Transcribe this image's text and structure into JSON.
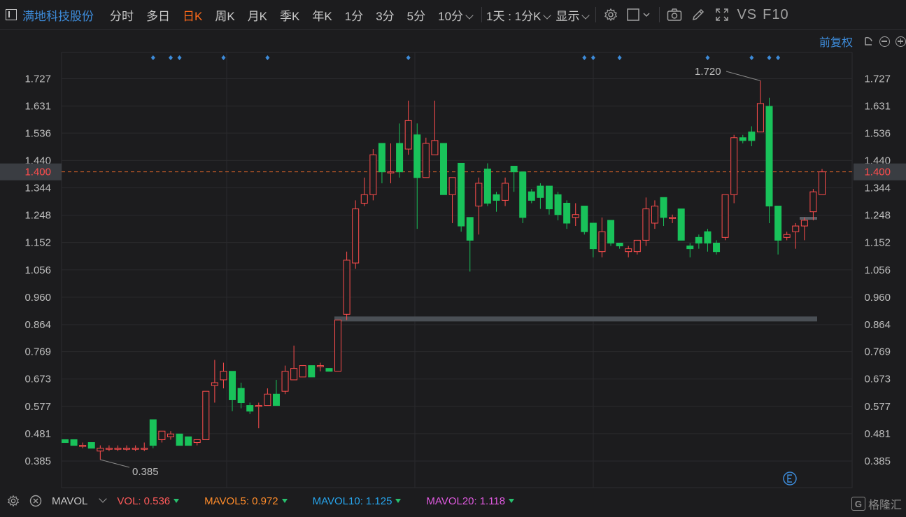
{
  "toolbar": {
    "stock_name": "满地科技股份",
    "periods": [
      "分时",
      "多日",
      "日K",
      "周K",
      "月K",
      "季K",
      "年K",
      "1分",
      "3分",
      "5分",
      "10分"
    ],
    "active_period": "日K",
    "interval_label": "1天 : 1分K",
    "display_label": "显示",
    "vs_label": "VS",
    "f10_label": "F10"
  },
  "subheader": {
    "adjust_label": "前复权"
  },
  "chart_data": {
    "type": "candlestick",
    "y_ticks": [
      "1.727",
      "1.631",
      "1.536",
      "1.440",
      "1.344",
      "1.248",
      "1.152",
      "1.056",
      "0.960",
      "0.864",
      "0.769",
      "0.673",
      "0.577",
      "0.481",
      "0.385"
    ],
    "ylim": [
      0.385,
      1.727
    ],
    "current_price": "1.400",
    "max_label": "1.720",
    "min_label": "0.385",
    "candles": [
      [
        0.46,
        0.45,
        0.46,
        0.45
      ],
      [
        0.46,
        0.44,
        0.46,
        0.44
      ],
      [
        0.44,
        0.44,
        0.45,
        0.43
      ],
      [
        0.45,
        0.43,
        0.45,
        0.43
      ],
      [
        0.42,
        0.43,
        0.44,
        0.39
      ],
      [
        0.43,
        0.43,
        0.44,
        0.42
      ],
      [
        0.43,
        0.43,
        0.44,
        0.42
      ],
      [
        0.43,
        0.43,
        0.44,
        0.42
      ],
      [
        0.43,
        0.43,
        0.44,
        0.42
      ],
      [
        0.43,
        0.43,
        0.45,
        0.42
      ],
      [
        0.53,
        0.44,
        0.53,
        0.43
      ],
      [
        0.46,
        0.49,
        0.49,
        0.45
      ],
      [
        0.47,
        0.48,
        0.49,
        0.46
      ],
      [
        0.48,
        0.44,
        0.48,
        0.44
      ],
      [
        0.47,
        0.44,
        0.47,
        0.44
      ],
      [
        0.45,
        0.46,
        0.46,
        0.44
      ],
      [
        0.46,
        0.63,
        0.63,
        0.46
      ],
      [
        0.65,
        0.66,
        0.74,
        0.59
      ],
      [
        0.67,
        0.7,
        0.73,
        0.64
      ],
      [
        0.7,
        0.6,
        0.7,
        0.56
      ],
      [
        0.64,
        0.59,
        0.66,
        0.57
      ],
      [
        0.58,
        0.56,
        0.59,
        0.55
      ],
      [
        0.58,
        0.58,
        0.59,
        0.5
      ],
      [
        0.58,
        0.62,
        0.64,
        0.58
      ],
      [
        0.62,
        0.58,
        0.67,
        0.58
      ],
      [
        0.63,
        0.7,
        0.72,
        0.62
      ],
      [
        0.67,
        0.71,
        0.79,
        0.67
      ],
      [
        0.68,
        0.72,
        0.72,
        0.68
      ],
      [
        0.72,
        0.68,
        0.72,
        0.68
      ],
      [
        0.72,
        0.72,
        0.73,
        0.7
      ],
      [
        0.71,
        0.7,
        0.71,
        0.7
      ],
      [
        0.7,
        0.88,
        0.88,
        0.7
      ],
      [
        0.9,
        1.09,
        1.12,
        0.88
      ],
      [
        1.08,
        1.27,
        1.3,
        1.06
      ],
      [
        1.29,
        1.32,
        1.38,
        1.28
      ],
      [
        1.32,
        1.46,
        1.48,
        1.3
      ],
      [
        1.5,
        1.4,
        1.49,
        1.36
      ],
      [
        1.4,
        1.4,
        1.5,
        1.36
      ],
      [
        1.5,
        1.4,
        1.57,
        1.38
      ],
      [
        1.48,
        1.58,
        1.65,
        1.46
      ],
      [
        1.53,
        1.38,
        1.57,
        1.2
      ],
      [
        1.38,
        1.5,
        1.52,
        1.38
      ],
      [
        1.46,
        1.51,
        1.65,
        1.46
      ],
      [
        1.5,
        1.32,
        1.5,
        1.32
      ],
      [
        1.32,
        1.38,
        1.38,
        1.22
      ],
      [
        1.43,
        1.21,
        1.43,
        1.19
      ],
      [
        1.24,
        1.16,
        1.24,
        1.05
      ],
      [
        1.28,
        1.36,
        1.38,
        1.18
      ],
      [
        1.41,
        1.29,
        1.43,
        1.28
      ],
      [
        1.32,
        1.3,
        1.33,
        1.26
      ],
      [
        1.3,
        1.36,
        1.38,
        1.28
      ],
      [
        1.42,
        1.4,
        1.42,
        1.33
      ],
      [
        1.4,
        1.24,
        1.4,
        1.22
      ],
      [
        1.33,
        1.3,
        1.34,
        1.29
      ],
      [
        1.35,
        1.31,
        1.36,
        1.27
      ],
      [
        1.35,
        1.27,
        1.35,
        1.25
      ],
      [
        1.32,
        1.25,
        1.33,
        1.23
      ],
      [
        1.29,
        1.22,
        1.3,
        1.2
      ],
      [
        1.24,
        1.25,
        1.29,
        1.21
      ],
      [
        1.28,
        1.19,
        1.28,
        1.18
      ],
      [
        1.22,
        1.13,
        1.22,
        1.1
      ],
      [
        1.12,
        1.19,
        1.24,
        1.1
      ],
      [
        1.23,
        1.15,
        1.23,
        1.14
      ],
      [
        1.15,
        1.14,
        1.15,
        1.13
      ],
      [
        1.12,
        1.13,
        1.14,
        1.1
      ],
      [
        1.12,
        1.16,
        1.16,
        1.11
      ],
      [
        1.16,
        1.27,
        1.31,
        1.14
      ],
      [
        1.22,
        1.28,
        1.3,
        1.2
      ],
      [
        1.31,
        1.24,
        1.31,
        1.21
      ],
      [
        1.24,
        1.24,
        1.25,
        1.22
      ],
      [
        1.27,
        1.16,
        1.27,
        1.16
      ],
      [
        1.14,
        1.13,
        1.15,
        1.1
      ],
      [
        1.17,
        1.15,
        1.18,
        1.13
      ],
      [
        1.19,
        1.15,
        1.2,
        1.12
      ],
      [
        1.15,
        1.12,
        1.16,
        1.11
      ],
      [
        1.17,
        1.32,
        1.32,
        1.16
      ],
      [
        1.32,
        1.52,
        1.53,
        1.29
      ],
      [
        1.52,
        1.51,
        1.53,
        1.5
      ],
      [
        1.54,
        1.51,
        1.56,
        1.49
      ],
      [
        1.54,
        1.64,
        1.72,
        1.54
      ],
      [
        1.63,
        1.28,
        1.66,
        1.22
      ],
      [
        1.28,
        1.16,
        1.28,
        1.11
      ],
      [
        1.17,
        1.18,
        1.19,
        1.16
      ],
      [
        1.19,
        1.21,
        1.22,
        1.13
      ],
      [
        1.21,
        1.23,
        1.24,
        1.16
      ],
      [
        1.26,
        1.33,
        1.34,
        1.23
      ],
      [
        1.32,
        1.4,
        1.41,
        1.32
      ]
    ],
    "support_band": 0.885,
    "event_markers_idx": [
      10,
      12,
      13,
      18,
      23,
      39,
      59,
      60,
      63,
      73,
      78,
      80,
      81
    ]
  },
  "footer": {
    "indicator": "MAVOL",
    "vol": {
      "label": "VOL:",
      "value": "0.536",
      "color": "#ff5a5a"
    },
    "mavol5": {
      "label": "MAVOL5:",
      "value": "0.972",
      "color": "#ff8c2a"
    },
    "mavol10": {
      "label": "MAVOL10:",
      "value": "1.125",
      "color": "#27a6ee"
    },
    "mavol20": {
      "label": "MAVOL20:",
      "value": "1.118",
      "color": "#e05ae0"
    },
    "brand": "格隆汇"
  },
  "colors": {
    "up": "#ff4d4d",
    "down": "#19c25a",
    "accent": "#ff6a1a",
    "link": "#3d8bd9"
  }
}
